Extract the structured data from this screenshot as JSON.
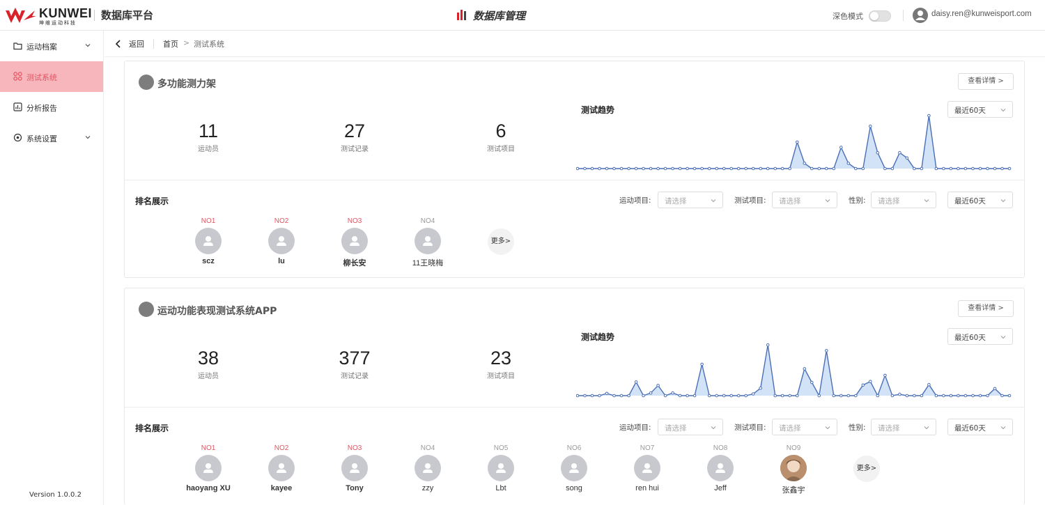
{
  "header": {
    "brand": "KUNWEI",
    "brand_sub": "坤维运动科技",
    "platform_name": "数据库平台",
    "center_title": "数据库管理",
    "dark_mode_label": "深色模式",
    "dark_mode_on": false,
    "user_email": "daisy.ren@kunweisport.com"
  },
  "sidebar": {
    "items": [
      {
        "label": "运动档案",
        "icon": "folder-icon",
        "expandable": true
      },
      {
        "label": "测试系统",
        "icon": "grid-icon",
        "active": true
      },
      {
        "label": "分析报告",
        "icon": "bar-chart-icon"
      },
      {
        "label": "系统设置",
        "icon": "settings-icon",
        "expandable": true
      }
    ],
    "version": "Version 1.0.0.2"
  },
  "breadcrumb": {
    "back": "返回",
    "home": "首页",
    "separator": ">",
    "current": "测试系统"
  },
  "colors": {
    "accent": "#e05563",
    "active_bg": "#f6b6bc",
    "chart_line": "#4a6fb5",
    "chart_fill": "#c7dcf6"
  },
  "cards": [
    {
      "title": "多功能测力架",
      "detail_btn": "查看详情 >",
      "stats": [
        {
          "value": "11",
          "label": "运动员"
        },
        {
          "value": "27",
          "label": "测试记录"
        },
        {
          "value": "6",
          "label": "测试项目"
        }
      ],
      "trend_title": "测试趋势",
      "trend_range": "最近60天",
      "rank_title": "排名展示",
      "filters": [
        {
          "label": "运动项目:",
          "placeholder": "请选择"
        },
        {
          "label": "测试项目:",
          "placeholder": "请选择"
        },
        {
          "label": "性别:",
          "placeholder": "请选择"
        }
      ],
      "rank_range": "最近60天",
      "ranking": [
        {
          "rank": "NO1",
          "name": "scz"
        },
        {
          "rank": "NO2",
          "name": "lu"
        },
        {
          "rank": "NO3",
          "name": "柳长安"
        },
        {
          "rank": "NO4",
          "name": "11王晓梅"
        }
      ],
      "more": "更多>"
    },
    {
      "title": "运动功能表现测试系统APP",
      "detail_btn": "查看详情 >",
      "stats": [
        {
          "value": "38",
          "label": "运动员"
        },
        {
          "value": "377",
          "label": "测试记录"
        },
        {
          "value": "23",
          "label": "测试项目"
        }
      ],
      "trend_title": "测试趋势",
      "trend_range": "最近60天",
      "rank_title": "排名展示",
      "filters": [
        {
          "label": "运动项目:",
          "placeholder": "请选择"
        },
        {
          "label": "测试项目:",
          "placeholder": "请选择"
        },
        {
          "label": "性别:",
          "placeholder": "请选择"
        }
      ],
      "rank_range": "最近60天",
      "ranking": [
        {
          "rank": "NO1",
          "name": "haoyang XU"
        },
        {
          "rank": "NO2",
          "name": "kayee"
        },
        {
          "rank": "NO3",
          "name": "Tony"
        },
        {
          "rank": "NO4",
          "name": "zzy"
        },
        {
          "rank": "NO5",
          "name": "Lbt"
        },
        {
          "rank": "NO6",
          "name": "song"
        },
        {
          "rank": "NO7",
          "name": "ren hui"
        },
        {
          "rank": "NO8",
          "name": "Jeff"
        },
        {
          "rank": "NO9",
          "name": "张鑫宇",
          "photo": true
        }
      ],
      "more": "更多>"
    }
  ],
  "chart_data": [
    {
      "type": "area",
      "title": "测试趋势",
      "x_count": 60,
      "values": [
        0,
        0,
        0,
        0,
        0,
        0,
        0,
        0,
        0,
        0,
        0,
        0,
        0,
        0,
        0,
        0,
        0,
        0,
        0,
        0,
        0,
        0,
        0,
        0,
        0,
        0,
        0,
        0,
        0,
        0,
        5,
        1,
        0,
        0,
        0,
        0,
        4,
        1,
        0,
        0,
        8,
        3,
        0,
        0,
        3,
        2,
        0,
        0,
        10,
        0,
        0,
        0,
        0,
        0,
        0,
        0,
        0,
        0,
        0,
        0
      ],
      "ylim": [
        0,
        10
      ]
    },
    {
      "type": "area",
      "title": "测试趋势",
      "x_count": 60,
      "values": [
        0,
        0,
        0,
        0,
        0.5,
        0,
        0,
        0,
        3.1,
        0,
        0.6,
        2.3,
        0,
        0.6,
        0,
        0,
        0,
        7.1,
        0,
        0,
        0,
        0,
        0,
        0,
        0.4,
        1.7,
        11.5,
        0,
        0,
        0,
        0,
        6.1,
        3,
        0,
        10.2,
        0,
        0,
        0,
        0,
        2.4,
        3.2,
        0,
        4.6,
        0,
        0.3,
        0,
        0,
        0,
        2.5,
        0,
        0,
        0,
        0,
        0,
        0,
        0,
        0,
        1.6,
        0,
        0
      ],
      "ylim": [
        0,
        12
      ]
    }
  ]
}
